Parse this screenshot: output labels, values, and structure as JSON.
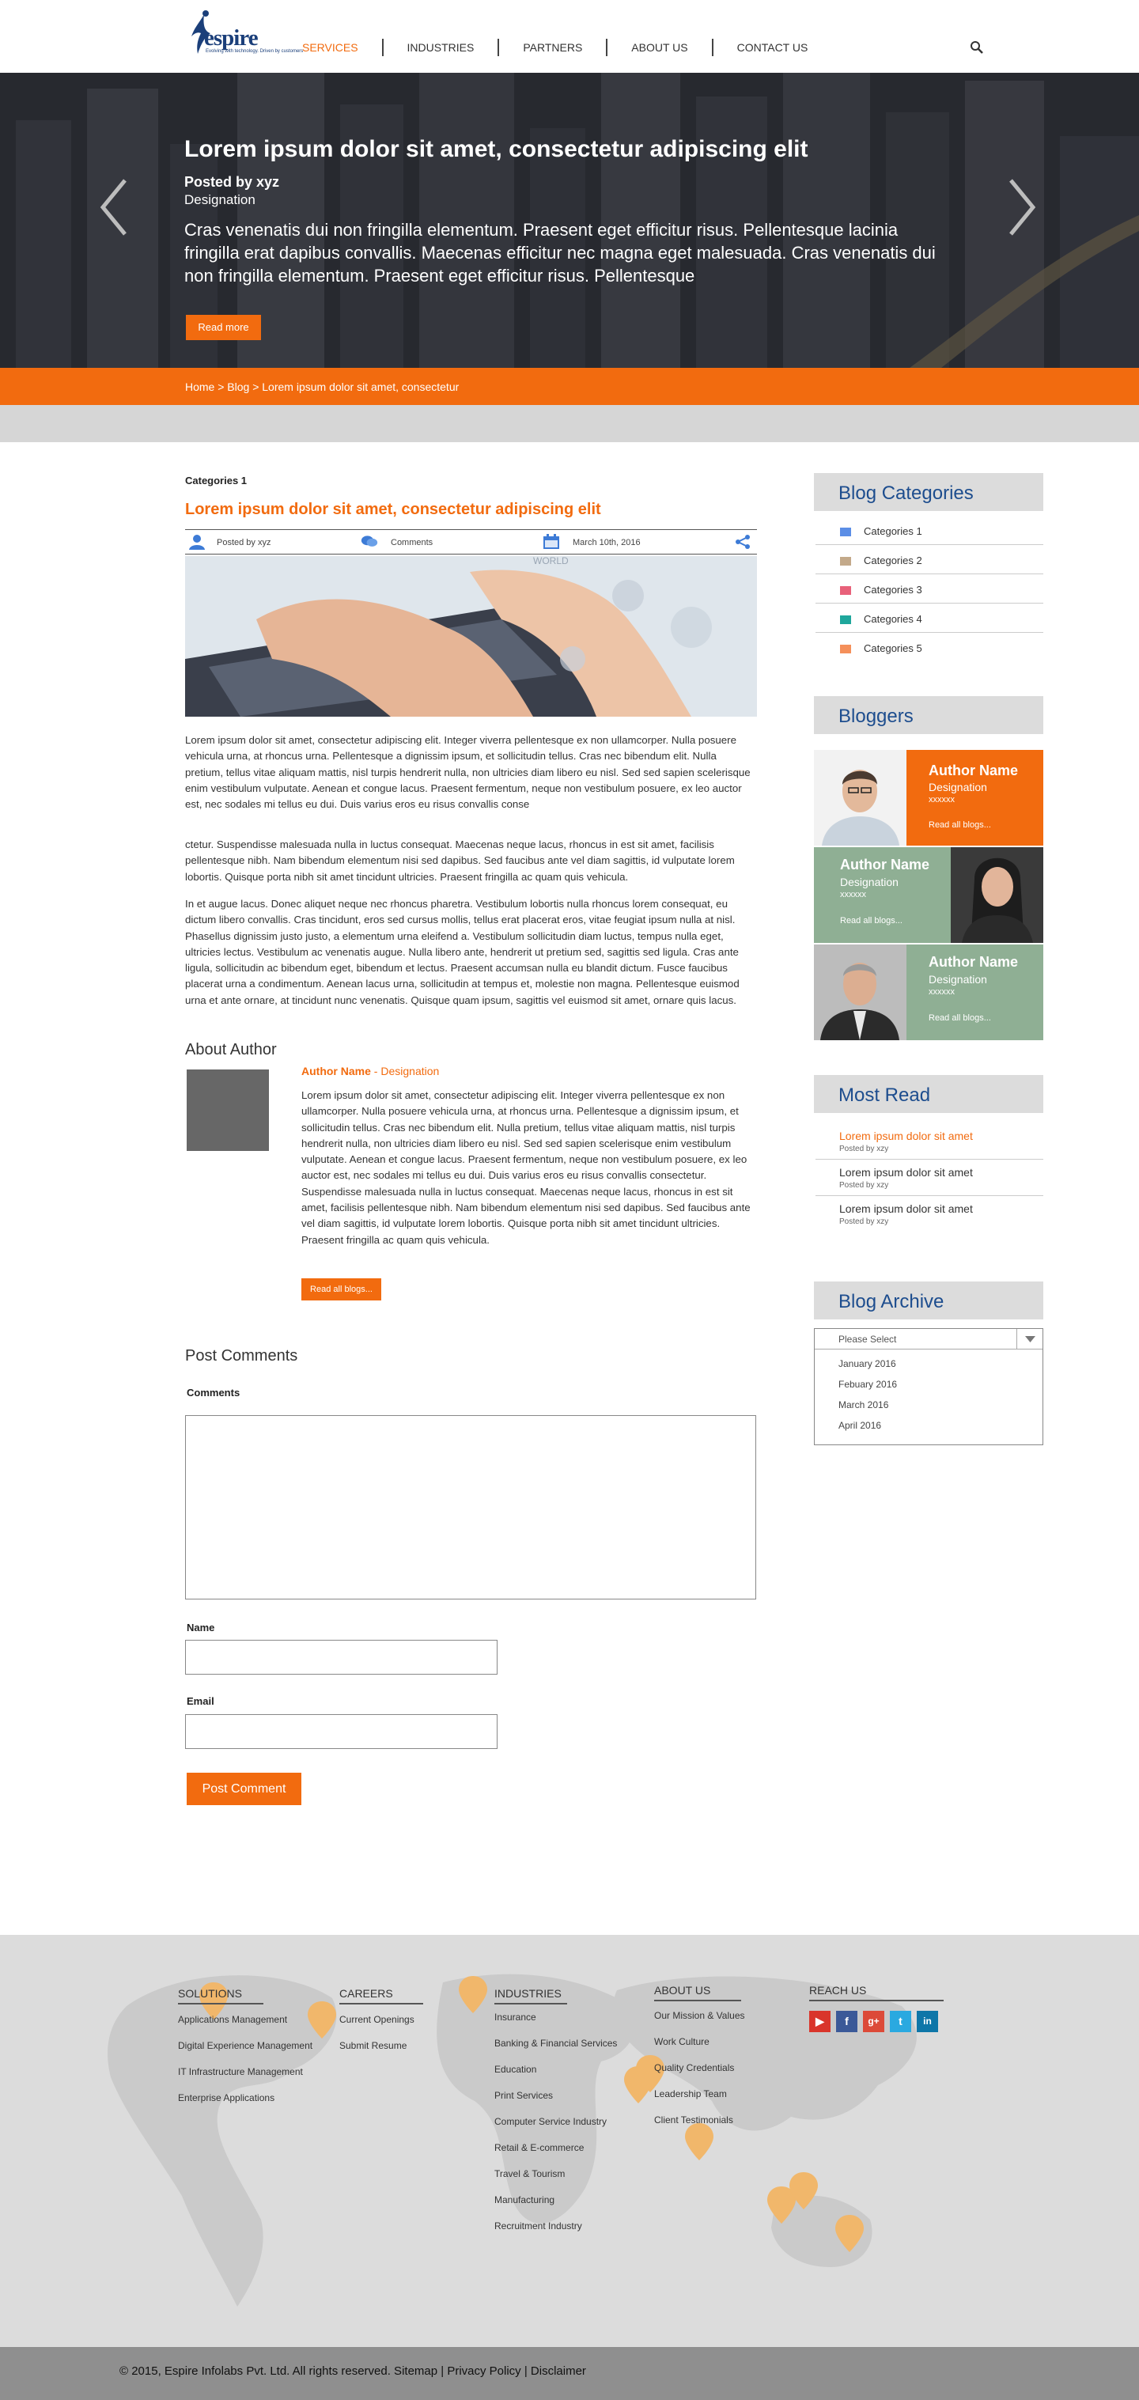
{
  "header": {
    "logo_text": "espire",
    "logo_tagline": "Evolving with technology. Driven by customers",
    "nav": [
      {
        "label": "SERVICES",
        "active": true
      },
      {
        "label": "INDUSTRIES",
        "active": false
      },
      {
        "label": "PARTNERS",
        "active": false
      },
      {
        "label": "ABOUT US",
        "active": false
      },
      {
        "label": "CONTACT US",
        "active": false
      }
    ],
    "search_icon": "magnifier-icon"
  },
  "hero": {
    "title": "Lorem ipsum dolor sit amet, consectetur adipiscing elit",
    "posted_by": "Posted by xyz",
    "designation": "Designation",
    "body": "Cras venenatis dui non fringilla elementum. Praesent eget efficitur risus. Pellentesque lacinia fringilla erat dapibus convallis. Maecenas efficitur nec magna eget malesuada. Cras venenatis dui non fringilla elementum. Praesent eget efficitur risus. Pellentesque",
    "read_more": "Read more",
    "prev_icon": "chevron-left-icon",
    "next_icon": "chevron-right-icon"
  },
  "breadcrumb": "Home > Blog > Lorem ipsum dolor sit amet, consectetur",
  "post": {
    "category": "Categories 1",
    "title": "Lorem ipsum dolor sit amet, consectetur adipiscing elit",
    "meta": {
      "author": "Posted by xyz",
      "comments": "Comments",
      "date": "March 10th, 2016"
    },
    "image_alt_text": "WORLD",
    "paragraphs": [
      "Lorem ipsum dolor sit amet, consectetur adipiscing elit. Integer viverra pellentesque ex non ullamcorper. Nulla posuere vehicula urna, at rhoncus urna. Pellentesque a dignissim ipsum, et sollicitudin tellus. Cras nec bibendum elit. Nulla pretium, tellus vitae aliquam mattis, nisl turpis hendrerit nulla, non ultricies diam libero eu nisl. Sed sed sapien scelerisque enim vestibulum vulputate. Aenean et congue lacus. Praesent fermentum, neque non vestibulum posuere, ex leo auctor est, nec sodales mi tellus eu dui. Duis varius eros eu risus convallis conse",
      "ctetur. Suspendisse malesuada nulla in luctus consequat. Maecenas neque lacus, rhoncus in est sit amet, facilisis pellentesque nibh. Nam bibendum elementum nisi sed dapibus. Sed faucibus ante vel diam sagittis, id vulputate lorem lobortis. Quisque porta nibh sit amet tincidunt ultricies. Praesent fringilla ac quam quis vehicula.",
      "In et augue lacus. Donec aliquet neque nec rhoncus pharetra. Vestibulum lobortis nulla rhoncus lorem consequat, eu dictum libero convallis. Cras tincidunt, eros sed cursus mollis, tellus erat placerat eros, vitae feugiat ipsum nulla at nisl. Phasellus dignissim justo justo, a elementum urna eleifend a. Vestibulum sollicitudin diam luctus, tempus nulla eget, ultricies lectus. Vestibulum ac venenatis augue. Nulla libero ante, hendrerit ut pretium sed, sagittis sed ligula. Cras ante ligula, sollicitudin ac bibendum eget, bibendum et lectus. Praesent accumsan nulla eu blandit dictum. Fusce faucibus placerat urna a condimentum. Aenean lacus urna, sollicitudin at tempus et, molestie non magna. Pellentesque euismod urna et ante ornare, at tincidunt nunc venenatis. Quisque quam ipsum, sagittis vel euismod sit amet, ornare quis lacus."
    ]
  },
  "about_author": {
    "heading": "About Author",
    "name": "Author Name",
    "separator": " - ",
    "designation": "Designation",
    "text": "Lorem ipsum dolor sit amet, consectetur adipiscing elit. Integer viverra pellentesque ex non ullamcorper. Nulla posuere vehicula urna, at rhoncus urna. Pellentesque a dignissim ipsum, et sollicitudin tellus. Cras nec bibendum elit. Nulla pretium, tellus vitae aliquam mattis, nisl turpis hendrerit nulla, non ultricies diam libero eu nisl. Sed sed sapien scelerisque enim vestibulum vulputate. Aenean et congue lacus. Praesent fermentum, neque non vestibulum posuere, ex leo auctor est, nec sodales mi tellus eu dui. Duis varius eros eu risus convallis consectetur. Suspendisse malesuada nulla in luctus consequat. Maecenas neque lacus, rhoncus in est sit amet, facilisis pellentesque nibh. Nam bibendum elementum nisi sed dapibus. Sed faucibus ante vel diam sagittis, id vulputate lorem lobortis. Quisque porta nibh sit amet tincidunt ultricies. Praesent fringilla ac quam quis vehicula.",
    "read_all": "Read all blogs..."
  },
  "comments_form": {
    "heading": "Post Comments",
    "comments_label": "Comments",
    "name_label": "Name",
    "email_label": "Email",
    "submit": "Post Comment"
  },
  "sidebar": {
    "categories": {
      "heading": "Blog Categories",
      "items": [
        {
          "label": "Categories 1",
          "color": "#5b8ee6"
        },
        {
          "label": "Categories 2",
          "color": "#c3a98a"
        },
        {
          "label": "Categories 3",
          "color": "#e8617a"
        },
        {
          "label": "Categories 4",
          "color": "#1fa79c"
        },
        {
          "label": "Categories 5",
          "color": "#f5905a"
        }
      ]
    },
    "bloggers": {
      "heading": "Bloggers",
      "items": [
        {
          "name": "Author Name",
          "designation": "Designation",
          "code": "xxxxxx",
          "read": "Read all blogs...",
          "bg": "#f26b0f"
        },
        {
          "name": "Author Name",
          "designation": "Designation",
          "code": "xxxxxx",
          "read": "Read all blogs...",
          "bg": "#8faf94"
        },
        {
          "name": "Author Name",
          "designation": "Designation",
          "code": "xxxxxx",
          "read": "Read all blogs...",
          "bg": "#8faf94"
        }
      ]
    },
    "most_read": {
      "heading": "Most Read",
      "items": [
        {
          "title": "Lorem ipsum dolor sit amet",
          "sub": "Posted by xzy",
          "highlight": true
        },
        {
          "title": "Lorem ipsum dolor sit amet",
          "sub": "Posted by xzy",
          "highlight": false
        },
        {
          "title": "Lorem ipsum dolor sit amet",
          "sub": "Posted by xzy",
          "highlight": false
        }
      ]
    },
    "archive": {
      "heading": "Blog Archive",
      "placeholder": "Please Select",
      "options": [
        "January 2016",
        "Febuary 2016",
        "March 2016",
        "April 2016"
      ]
    }
  },
  "footer": {
    "solutions": {
      "heading": "SOLUTIONS",
      "links": [
        "Applications Management",
        "Digital Experience Management",
        "IT Infrastructure Management",
        "Enterprise Applications"
      ]
    },
    "careers": {
      "heading": "CAREERS",
      "links": [
        "Current Openings",
        "Submit Resume"
      ]
    },
    "industries": {
      "heading": "INDUSTRIES",
      "links": [
        "Insurance",
        "Banking & Financial Services",
        "Education",
        "Print Services",
        "Computer Service Industry",
        "Retail & E-commerce",
        "Travel & Tourism",
        "Manufacturing",
        "Recruitment Industry"
      ]
    },
    "about": {
      "heading": "ABOUT US",
      "links": [
        "Our Mission & Values",
        "Work Culture",
        "Quality Credentials",
        "Leadership Team",
        "Client Testimonials"
      ]
    },
    "reach": {
      "heading": "REACH US",
      "social": [
        {
          "icon": "youtube-icon",
          "glyph": "▶",
          "color": "#d9352b"
        },
        {
          "icon": "facebook-icon",
          "glyph": "f",
          "color": "#3b5998"
        },
        {
          "icon": "google-plus-icon",
          "glyph": "g+",
          "color": "#dc4a38"
        },
        {
          "icon": "twitter-icon",
          "glyph": "t",
          "color": "#2aa9e0"
        },
        {
          "icon": "linkedin-icon",
          "glyph": "in",
          "color": "#0e76a8"
        }
      ]
    },
    "copyright": "© 2015, Espire Infolabs Pvt. Ltd. All rights reserved. Sitemap | Privacy Policy | Disclaimer"
  }
}
